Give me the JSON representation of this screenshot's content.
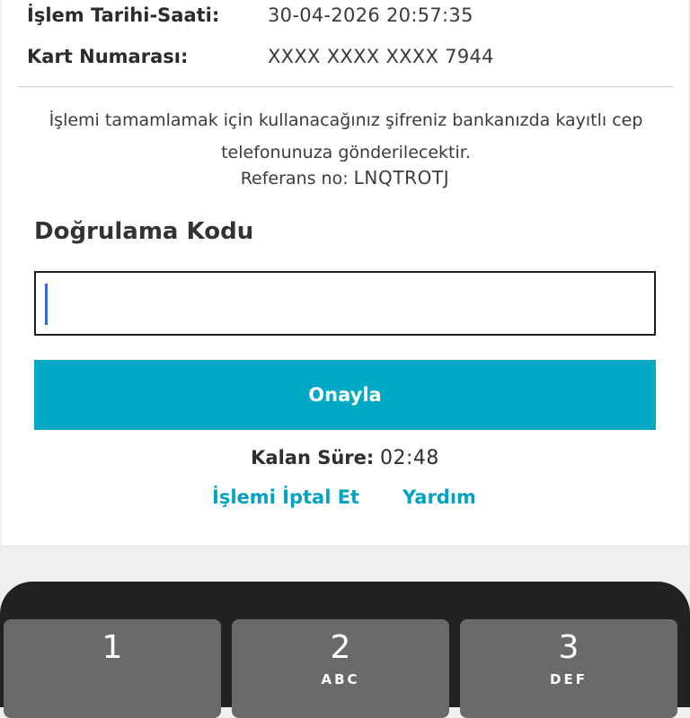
{
  "transaction": {
    "date_label": "İşlem Tarihi-Saati:",
    "date_value": "30-04-2026 20:57:35",
    "card_label": "Kart Numarası:",
    "card_value": "XXXX XXXX XXXX 7944"
  },
  "info": {
    "line1": "İşlemi tamamlamak için kullanacağınız şifreniz bankanızda kayıtlı cep",
    "line2": "telefonunuza gönderilecektir.",
    "ref_label": "Referans no:",
    "ref_value": "LNQTROTJ"
  },
  "verification": {
    "title": "Doğrulama Kodu",
    "input_value": "",
    "confirm_label": "Onayla"
  },
  "timer": {
    "label": "Kalan Süre:",
    "value": "02:48"
  },
  "links": {
    "cancel": "İşlemi İptal Et",
    "help": "Yardım"
  },
  "keypad": {
    "keys": [
      {
        "num": "1",
        "letters": ""
      },
      {
        "num": "2",
        "letters": "ABC"
      },
      {
        "num": "3",
        "letters": "DEF"
      }
    ]
  },
  "colors": {
    "accent": "#00a9c6",
    "link": "#00a3c2",
    "caret": "#3b64d6"
  }
}
